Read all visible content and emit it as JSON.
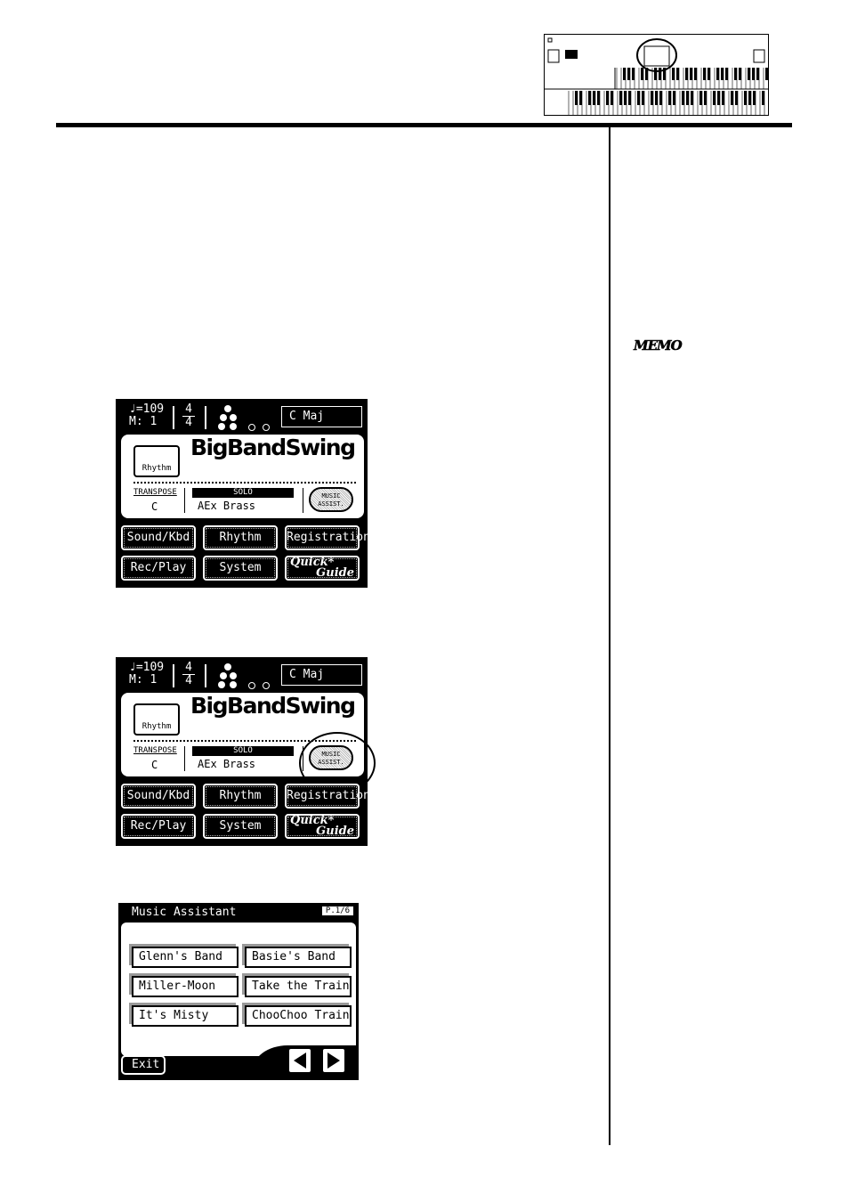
{
  "memo_label": "MEMO",
  "main_screen": {
    "tempo": "♩=109",
    "measure": "M:  1",
    "beat_num": "4",
    "beat_den": "4",
    "key": "C Maj",
    "folder_label": "Rhythm",
    "rhythm_name": "BigBandSwing",
    "transpose_label": "TRANSPOSE",
    "transpose_value": "C",
    "solo_label": "SOLO",
    "solo_value": "AEx Brass",
    "music_assist_line1": "MUSIC",
    "music_assist_line2": "ASSIST.",
    "buttons": [
      "Sound/Kbd",
      "Rhythm",
      "Registration",
      "Rec/Play",
      "System"
    ],
    "quick_guide_line1": "Quick*",
    "quick_guide_line2": "Guide"
  },
  "music_assistant": {
    "title": "Music Assistant",
    "page": "P.1/6",
    "options": [
      "Glenn's Band",
      "Basie's Band",
      "Miller-Moon",
      "Take the Train",
      "It's Misty",
      "ChooChoo Train"
    ],
    "exit_label": "Exit",
    "prev_icon": "triangle-left",
    "next_icon": "triangle-right"
  }
}
